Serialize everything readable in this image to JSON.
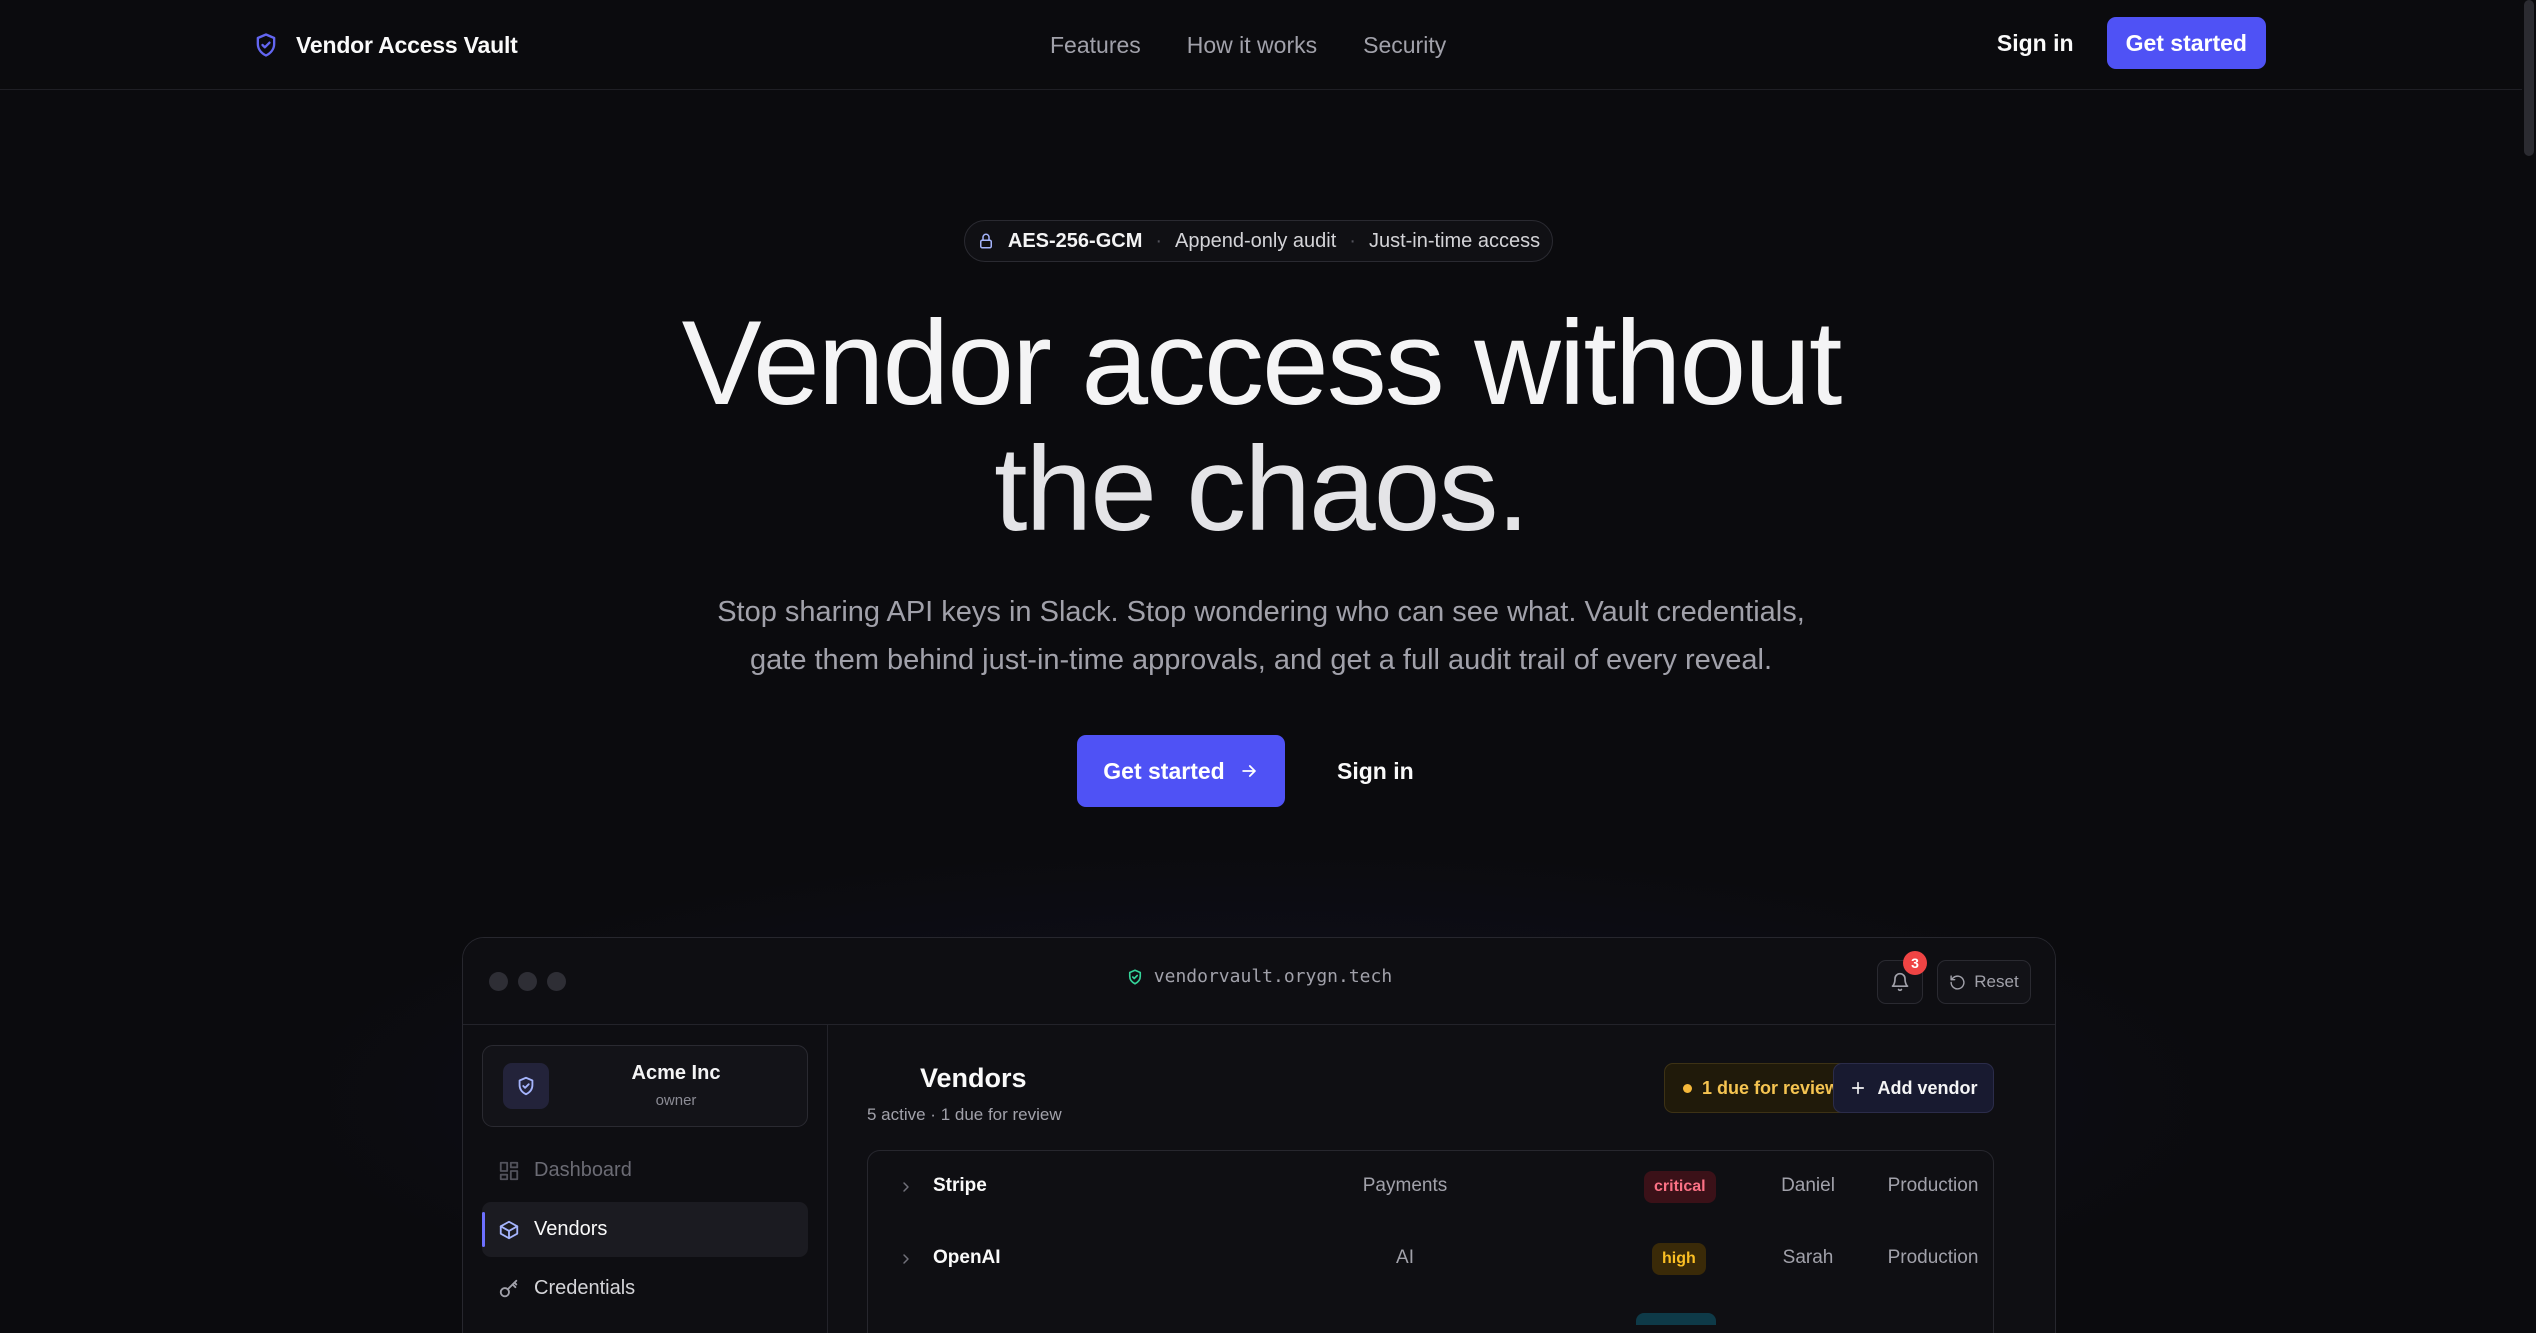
{
  "nav": {
    "brand": "Vendor Access Vault",
    "links": [
      "Features",
      "How it works",
      "Security"
    ],
    "signin": "Sign in",
    "get_started": "Get started"
  },
  "hero": {
    "pill": {
      "item1": "AES-256-GCM",
      "item2": "Append-only audit",
      "item3": "Just-in-time access",
      "sep": "·"
    },
    "title_line1": "Vendor access without",
    "title_line2": "the chaos.",
    "subtitle_line1": "Stop sharing API keys in Slack. Stop wondering who can see what. Vault credentials,",
    "subtitle_line2": "gate them behind just-in-time approvals, and get a full audit trail of every reveal.",
    "cta_primary": "Get started",
    "cta_secondary": "Sign in"
  },
  "preview": {
    "url": "vendorvault.orygn.tech",
    "notifications_count": "3",
    "reset_label": "Reset",
    "org": {
      "name": "Acme Inc",
      "role": "owner"
    },
    "sidebar": [
      {
        "label": "Dashboard",
        "icon": "grid-icon"
      },
      {
        "label": "Vendors",
        "icon": "box-icon"
      },
      {
        "label": "Credentials",
        "icon": "key-icon"
      }
    ],
    "main": {
      "title": "Vendors",
      "subtitle": "5 active · 1 due for review",
      "due_badge": "1 due for review",
      "add_button": "Add vendor"
    },
    "vendors": [
      {
        "name": "Stripe",
        "category": "Payments",
        "risk": "critical",
        "owner": "Daniel",
        "env": "Production"
      },
      {
        "name": "OpenAI",
        "category": "AI",
        "risk": "high",
        "owner": "Sarah",
        "env": "Production"
      }
    ]
  },
  "colors": {
    "accent": "#4f52f5",
    "background": "#0b0b0e",
    "critical": "#fb7185",
    "high": "#fbbf24"
  }
}
